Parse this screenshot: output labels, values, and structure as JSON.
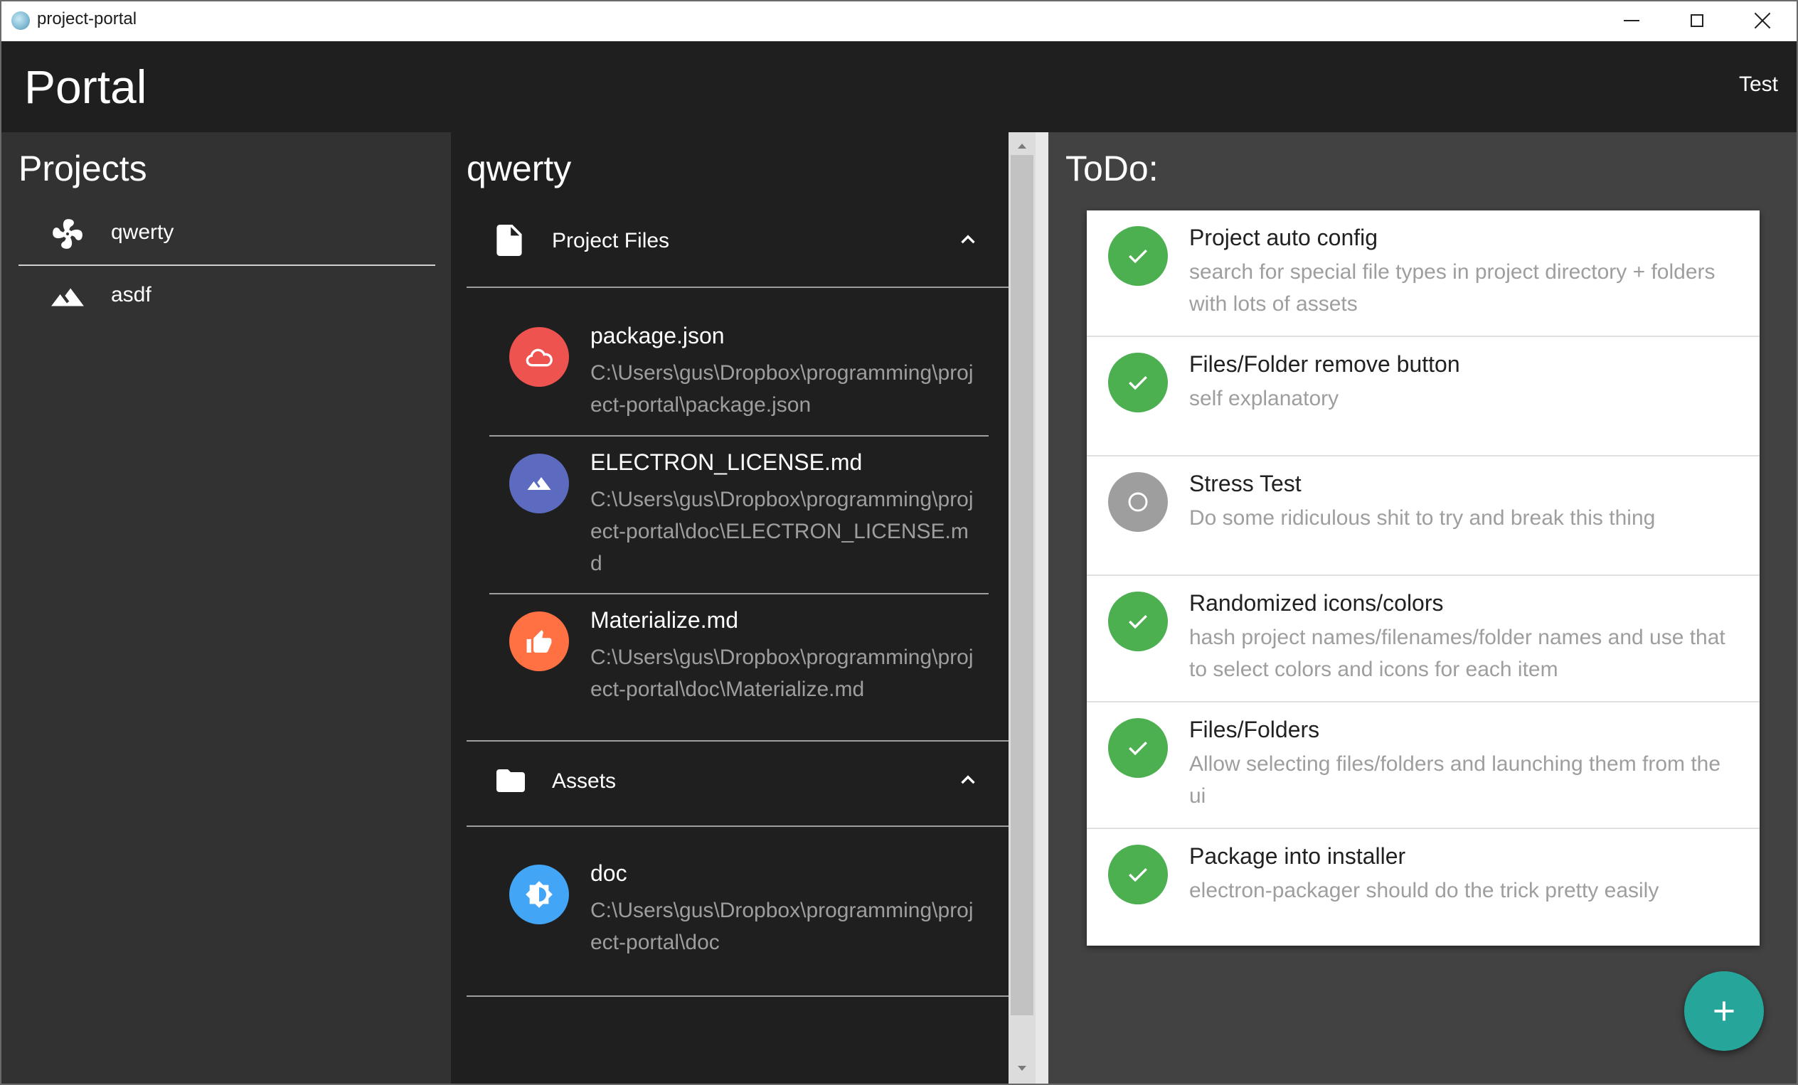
{
  "window": {
    "title": "project-portal"
  },
  "header": {
    "brand": "Portal",
    "link": "Test"
  },
  "projects": {
    "heading": "Projects",
    "items": [
      {
        "label": "qwerty",
        "icon": "pinwheel-icon"
      },
      {
        "label": "asdf",
        "icon": "landscape-icon"
      }
    ]
  },
  "project": {
    "heading": "qwerty",
    "sections": [
      {
        "title": "Project Files",
        "icon": "file-icon",
        "items": [
          {
            "name": "package.json",
            "path": "C:\\Users\\gus\\Dropbox\\programming\\project-portal\\package.json",
            "icon": "cloud-icon",
            "color": "#ef5350"
          },
          {
            "name": "ELECTRON_LICENSE.md",
            "path": "C:\\Users\\gus\\Dropbox\\programming\\project-portal\\doc\\ELECTRON_LICENSE.md",
            "icon": "landscape-icon",
            "color": "#5c6bc0"
          },
          {
            "name": "Materialize.md",
            "path": "C:\\Users\\gus\\Dropbox\\programming\\project-portal\\doc\\Materialize.md",
            "icon": "thumb-up-icon",
            "color": "#ff7043"
          }
        ]
      },
      {
        "title": "Assets",
        "icon": "folder-icon",
        "items": [
          {
            "name": "doc",
            "path": "C:\\Users\\gus\\Dropbox\\programming\\project-portal\\doc",
            "icon": "brightness-icon",
            "color": "#42a5f5"
          }
        ]
      }
    ]
  },
  "todo": {
    "heading": "ToDo:",
    "items": [
      {
        "title": "Project auto config",
        "desc": "search for special file types in project directory + folders with lots of assets",
        "done": true
      },
      {
        "title": "Files/Folder remove button",
        "desc": "self explanatory",
        "done": true
      },
      {
        "title": "Stress Test",
        "desc": "Do some ridiculous shit to try and break this thing",
        "done": false
      },
      {
        "title": "Randomized icons/colors",
        "desc": "hash project names/filenames/folder names and use that to select colors and icons for each item",
        "done": true
      },
      {
        "title": "Files/Folders",
        "desc": "Allow selecting files/folders and launching them from the ui",
        "done": true
      },
      {
        "title": "Package into installer",
        "desc": "electron-packager should do the trick pretty easily",
        "done": true
      }
    ]
  },
  "colors": {
    "done": "#4caf50",
    "pending": "#9e9e9e",
    "fab": "#26a69a",
    "appbar": "#1f1f1f"
  },
  "fab": {
    "icon": "plus-icon"
  }
}
